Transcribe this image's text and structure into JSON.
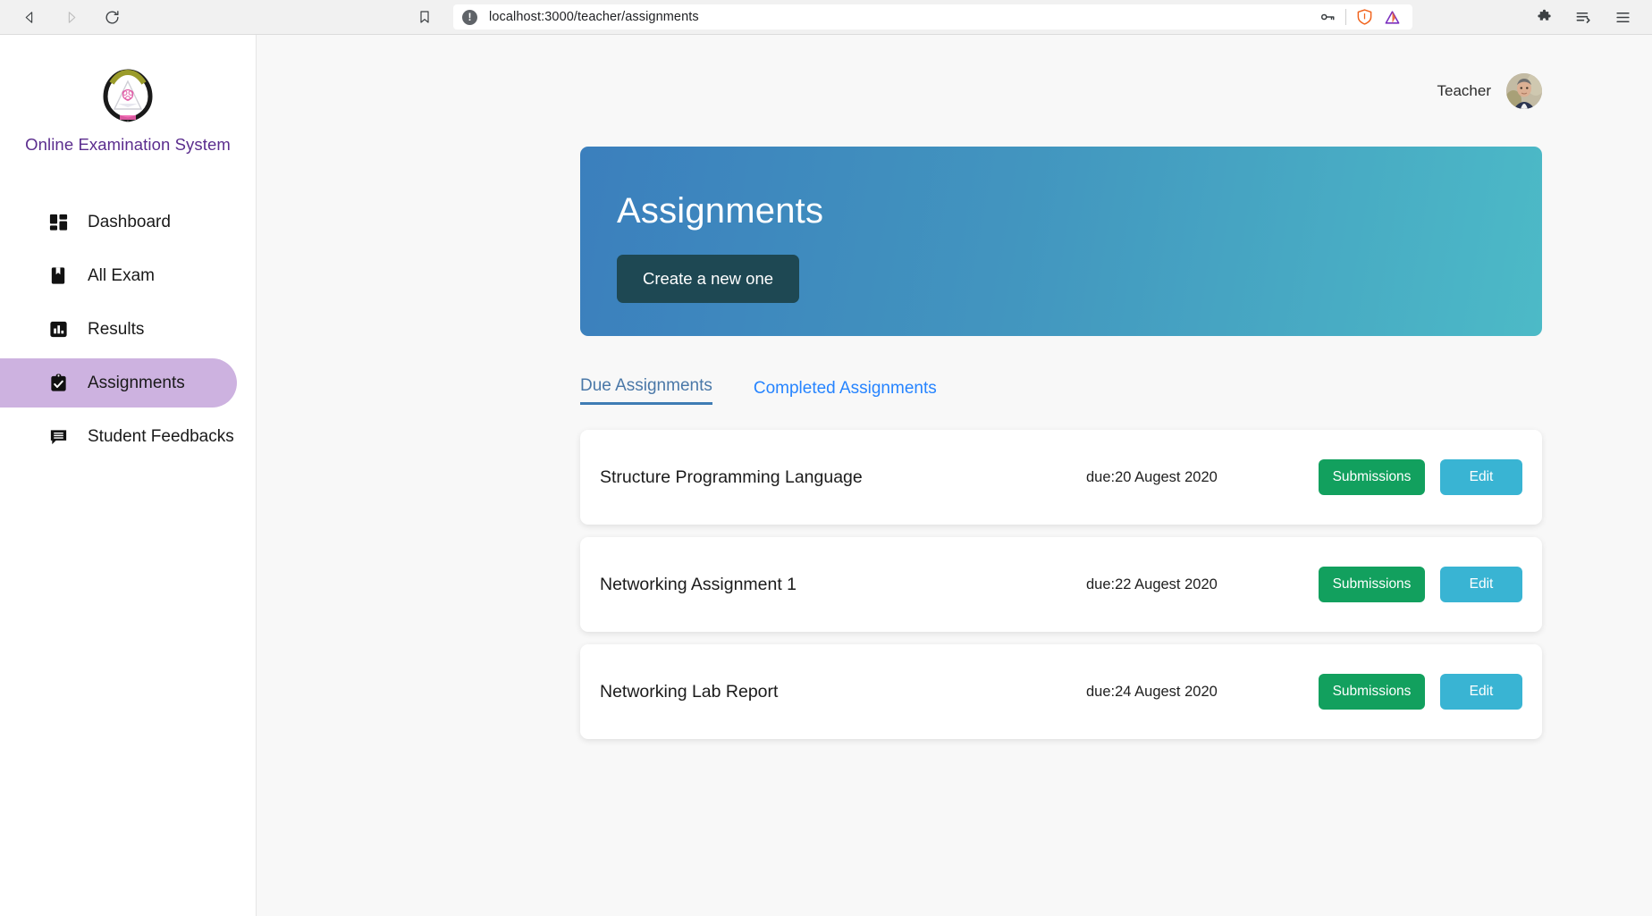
{
  "browser": {
    "back_icon": "back-arrow-icon",
    "forward_icon": "forward-arrow-icon",
    "reload_icon": "reload-icon",
    "bookmark_icon": "bookmark-icon",
    "url": "localhost:3000/teacher/assignments",
    "site_info_icon": "not-secure-info-icon",
    "password_icon": "key-icon",
    "shield_icon": "brave-shield-icon",
    "rewards_icon": "brave-rewards-triangle-icon",
    "extensions_icon": "puzzle-piece-icon",
    "reading_list_icon": "reading-list-icon",
    "menu_icon": "hamburger-menu-icon"
  },
  "sidebar": {
    "brand_title": "Online Examination System",
    "logo_icon": "university-crest-logo",
    "items": [
      {
        "label": "Dashboard",
        "icon": "dashboard-grid-icon",
        "active": false
      },
      {
        "label": "All Exam",
        "icon": "book-bookmark-icon",
        "active": false
      },
      {
        "label": "Results",
        "icon": "bar-chart-icon",
        "active": false
      },
      {
        "label": "Assignments",
        "icon": "clipboard-check-icon",
        "active": true
      },
      {
        "label": "Student Feedbacks",
        "icon": "comment-bubble-icon",
        "active": false
      }
    ]
  },
  "topbar": {
    "user_label": "Teacher",
    "avatar_icon": "user-avatar-photo"
  },
  "hero": {
    "title": "Assignments",
    "button_label": "Create a new one",
    "gradient_from": "#3b7fbd",
    "gradient_to": "#4cbac7",
    "button_color": "#1e4853"
  },
  "tabs": [
    {
      "label": "Due Assignments",
      "active": true
    },
    {
      "label": "Completed Assignments",
      "active": false
    }
  ],
  "assignments": [
    {
      "title": "Structure Programming Language",
      "due": "due:20 Augest 2020",
      "submissions_label": "Submissions",
      "edit_label": "Edit"
    },
    {
      "title": "Networking Assignment 1",
      "due": "due:22 Augest 2020",
      "submissions_label": "Submissions",
      "edit_label": "Edit"
    },
    {
      "title": "Networking Lab Report",
      "due": "due:24 Augest 2020",
      "submissions_label": "Submissions",
      "edit_label": "Edit"
    }
  ],
  "colors": {
    "accent_green": "#12a05e",
    "accent_blue": "#39b4d3",
    "active_nav": "#cdb2e0",
    "brand_purple": "#5b2d8e",
    "tab_active": "#4a78a8",
    "tab_link": "#2684ff"
  }
}
